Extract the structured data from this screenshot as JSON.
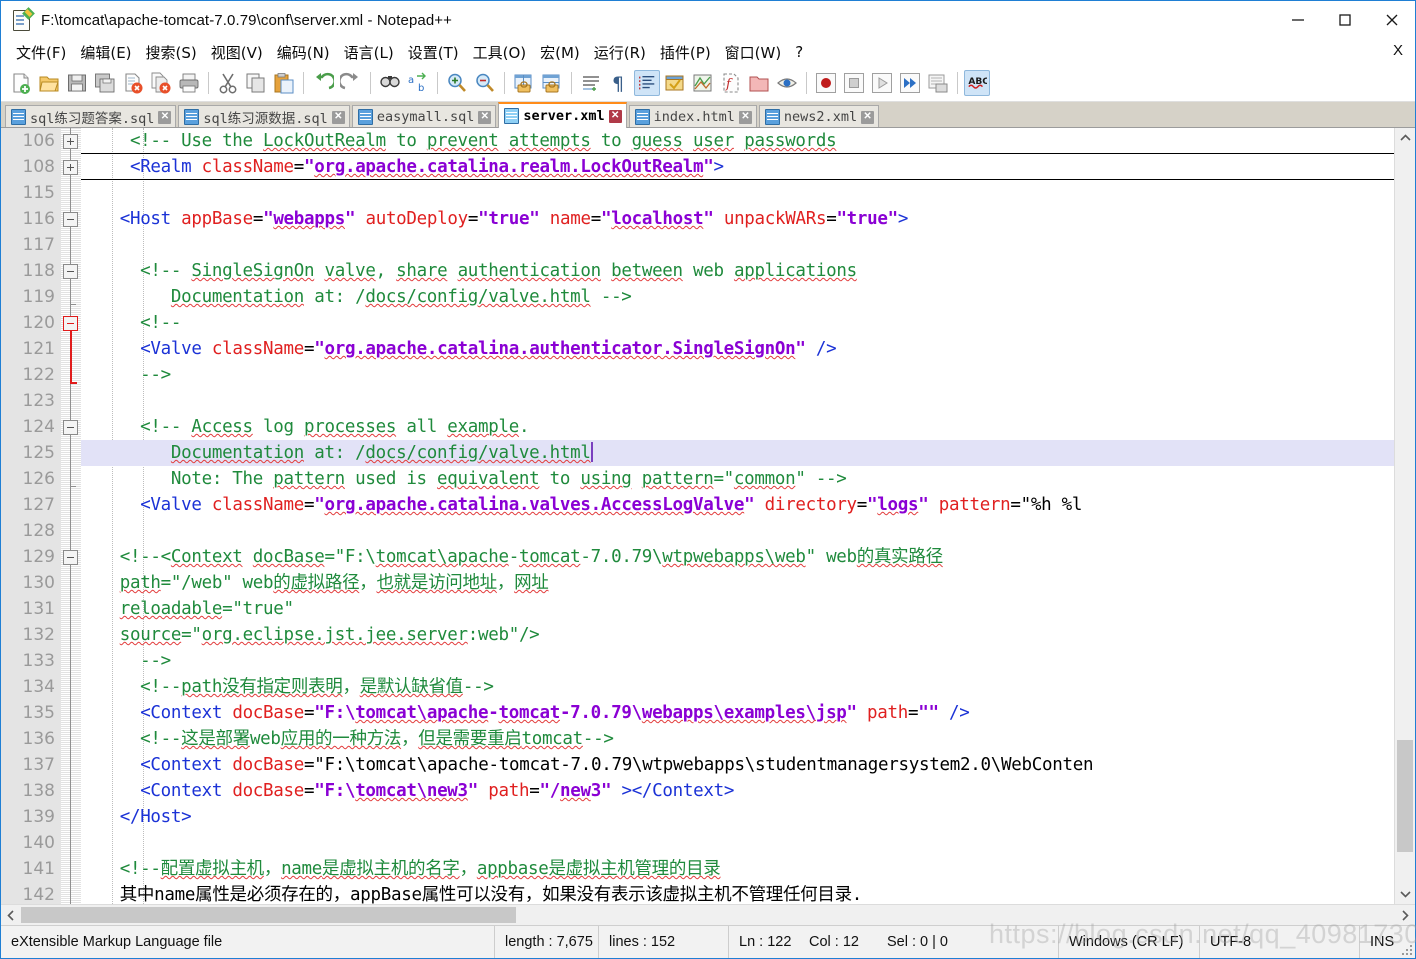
{
  "window": {
    "title": "F:\\tomcat\\apache-tomcat-7.0.79\\conf\\server.xml - Notepad++",
    "minimize_label": "—",
    "maximize_label": "□",
    "close_label": "✕"
  },
  "menu": {
    "items": [
      {
        "label": "文件(F)"
      },
      {
        "label": "编辑(E)"
      },
      {
        "label": "搜索(S)"
      },
      {
        "label": "视图(V)"
      },
      {
        "label": "编码(N)"
      },
      {
        "label": "语言(L)"
      },
      {
        "label": "设置(T)"
      },
      {
        "label": "工具(O)"
      },
      {
        "label": "宏(M)"
      },
      {
        "label": "运行(R)"
      },
      {
        "label": "插件(P)"
      },
      {
        "label": "窗口(W)"
      },
      {
        "label": "?"
      }
    ],
    "close_doc_label": "X"
  },
  "toolbar": {
    "buttons": [
      {
        "name": "new-file",
        "tooltip": "新建"
      },
      {
        "name": "open-file",
        "tooltip": "打开"
      },
      {
        "name": "save",
        "tooltip": "保存"
      },
      {
        "name": "save-all",
        "tooltip": "全部保存"
      },
      {
        "name": "close",
        "tooltip": "关闭"
      },
      {
        "name": "close-all",
        "tooltip": "关闭所有文档"
      },
      {
        "name": "print",
        "tooltip": "打印"
      },
      {
        "name": "cut",
        "tooltip": "剪切"
      },
      {
        "name": "copy",
        "tooltip": "复制"
      },
      {
        "name": "paste",
        "tooltip": "粘贴"
      },
      {
        "name": "undo",
        "tooltip": "撤销"
      },
      {
        "name": "redo",
        "tooltip": "恢复"
      },
      {
        "name": "find",
        "tooltip": "查找"
      },
      {
        "name": "replace",
        "tooltip": "替换"
      },
      {
        "name": "zoom-in",
        "tooltip": "放大"
      },
      {
        "name": "zoom-out",
        "tooltip": "缩小"
      },
      {
        "name": "sync-v-scroll",
        "tooltip": "同步垂直滚动"
      },
      {
        "name": "sync-h-scroll",
        "tooltip": "同步水平滚动"
      },
      {
        "name": "word-wrap",
        "tooltip": "自动换行"
      },
      {
        "name": "show-all-chars",
        "tooltip": "显示所有字符"
      },
      {
        "name": "indent-guide",
        "tooltip": "显示缩进参考线",
        "active": true
      },
      {
        "name": "user-language",
        "tooltip": "用户语言"
      },
      {
        "name": "doc-map",
        "tooltip": "文档地图"
      },
      {
        "name": "function-list",
        "tooltip": "函数列表"
      },
      {
        "name": "folder-workspace",
        "tooltip": "文件夹工作区"
      },
      {
        "name": "monitoring",
        "tooltip": "监视文件"
      },
      {
        "name": "record-macro",
        "tooltip": "开始录制宏"
      },
      {
        "name": "stop-macro",
        "tooltip": "停止录制宏"
      },
      {
        "name": "play-macro",
        "tooltip": "播放宏"
      },
      {
        "name": "run-macro-multi",
        "tooltip": "多次运行宏"
      },
      {
        "name": "save-macro",
        "tooltip": "保存当前录制的宏"
      },
      {
        "name": "spell-check",
        "tooltip": "拼写检查",
        "active": true
      }
    ]
  },
  "tabs": [
    {
      "label": "sql练习题答案.sql",
      "selected": false
    },
    {
      "label": "sql练习源数据.sql",
      "selected": false
    },
    {
      "label": "easymall.sql",
      "selected": false
    },
    {
      "label": "server.xml",
      "selected": true
    },
    {
      "label": "index.html",
      "selected": false
    },
    {
      "label": "news2.xml",
      "selected": false
    }
  ],
  "editor": {
    "current_line_index": 12,
    "lines": [
      {
        "num": "106",
        "fold": "plus",
        "text": "    <!-- Use the LockOutRealm to prevent attempts to guess user passwords"
      },
      {
        "num": "108",
        "fold": "plus",
        "text": "    <Realm className=\"org.apache.catalina.realm.LockOutRealm\">"
      },
      {
        "num": "115",
        "fold": "",
        "text": ""
      },
      {
        "num": "116",
        "fold": "minus",
        "text": "   <Host appBase=\"webapps\" autoDeploy=\"true\" name=\"localhost\" unpackWARs=\"true\">"
      },
      {
        "num": "117",
        "fold": "",
        "text": ""
      },
      {
        "num": "118",
        "fold": "minus",
        "text": "     <!-- SingleSignOn valve, share authentication between web applications"
      },
      {
        "num": "119",
        "fold": "tick",
        "text": "        Documentation at: /docs/config/valve.html -->"
      },
      {
        "num": "120",
        "fold": "minus-red",
        "text": "     <!--"
      },
      {
        "num": "121",
        "fold": "",
        "text": "     <Valve className=\"org.apache.catalina.authenticator.SingleSignOn\" />"
      },
      {
        "num": "122",
        "fold": "redfoot",
        "text": "     -->"
      },
      {
        "num": "123",
        "fold": "",
        "text": ""
      },
      {
        "num": "124",
        "fold": "minus",
        "text": "     <!-- Access log processes all example."
      },
      {
        "num": "125",
        "fold": "",
        "text": "        Documentation at: /docs/config/valve.html"
      },
      {
        "num": "126",
        "fold": "tick",
        "text": "        Note: The pattern used is equivalent to using pattern=\"common\" -->"
      },
      {
        "num": "127",
        "fold": "",
        "text": "     <Valve className=\"org.apache.catalina.valves.AccessLogValve\" directory=\"logs\" pattern=\"%h %l"
      },
      {
        "num": "128",
        "fold": "",
        "text": ""
      },
      {
        "num": "129",
        "fold": "minus",
        "text": "   <!--<Context docBase=\"F:\\tomcat\\apache-tomcat-7.0.79\\wtpwebapps\\web\" web的真实路径"
      },
      {
        "num": "130",
        "fold": "",
        "text": "   path=\"/web\" web的虚拟路径，也就是访问地址，网址"
      },
      {
        "num": "131",
        "fold": "",
        "text": "   reloadable=\"true\""
      },
      {
        "num": "132",
        "fold": "",
        "text": "   source=\"org.eclipse.jst.jee.server:web\"/>"
      },
      {
        "num": "133",
        "fold": "",
        "text": "     -->"
      },
      {
        "num": "134",
        "fold": "",
        "text": "     <!--path没有指定则表明，是默认缺省值-->"
      },
      {
        "num": "135",
        "fold": "",
        "text": "     <Context docBase=\"F:\\tomcat\\apache-tomcat-7.0.79\\webapps\\examples\\jsp\" path=\"\" />"
      },
      {
        "num": "136",
        "fold": "",
        "text": "     <!--这是部署web应用的一种方法，但是需要重启tomcat-->"
      },
      {
        "num": "137",
        "fold": "",
        "text": "     <Context docBase=\"F:\\tomcat\\apache-tomcat-7.0.79\\wtpwebapps\\studentmanagersystem2.0\\WebConten"
      },
      {
        "num": "138",
        "fold": "",
        "text": "     <Context docBase=\"F:\\tomcat\\new3\" path=\"/new3\" ></Context>"
      },
      {
        "num": "139",
        "fold": "",
        "text": "   </Host>"
      },
      {
        "num": "140",
        "fold": "",
        "text": ""
      },
      {
        "num": "141",
        "fold": "",
        "text": "   <!--配置虚拟主机，name是虚拟主机的名字，appbase是虚拟主机管理的目录"
      },
      {
        "num": "142",
        "fold": "",
        "text": "   其中name属性是必须存在的，appBase属性可以没有，如果没有表示该虚拟主机不管理任何目录."
      }
    ]
  },
  "statusbar": {
    "language": "eXtensible Markup Language file",
    "length_label": "length : 7,675",
    "lines_label": "lines : 152",
    "ln": "Ln : 122",
    "col": "Col : 12",
    "sel": "Sel : 0 | 0",
    "eol": "Windows (CR LF)",
    "encoding": "UTF-8",
    "insert_mode": "INS"
  },
  "watermark": {
    "text": "https://blog.csdn.net/qq_40981730"
  },
  "colors": {
    "comment": "#1f8a3c",
    "tag": "#1b32d6",
    "attribute": "#e02020",
    "value": "#8a00d4",
    "current_line": "#e2e2f7",
    "tab_selected_accent": "#ff8c1a",
    "window_border": "#1f7fd4"
  }
}
